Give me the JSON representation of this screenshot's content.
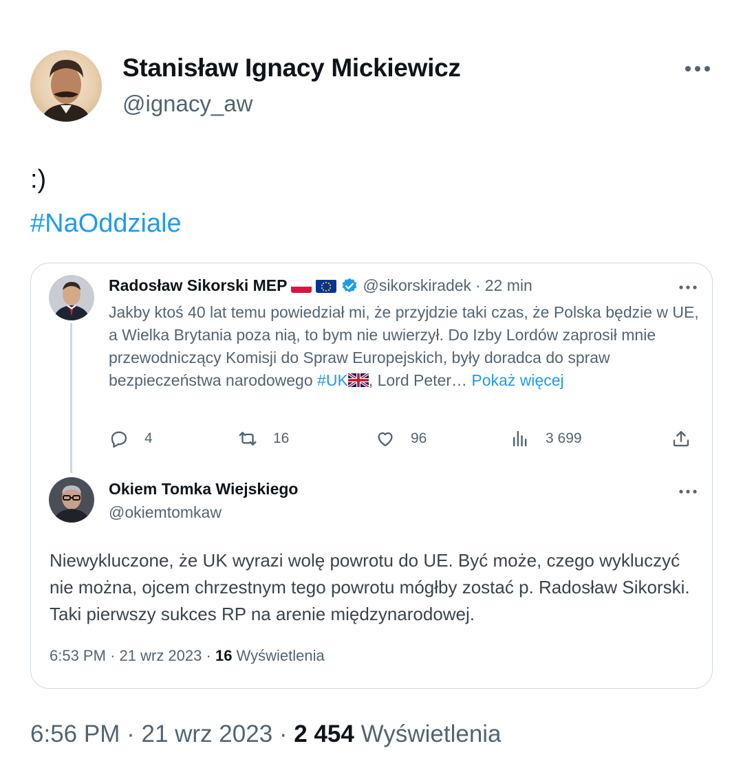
{
  "tweet": {
    "author_name": "Stanisław Ignacy Mickiewicz",
    "author_handle": "@ignacy_aw",
    "text_line1": ":)",
    "hashtag": "#NaOddziale",
    "time": "6:56 PM",
    "sep": "·",
    "date": "21 wrz 2023",
    "views_count": "2 454",
    "views_label": "Wyświetlenia"
  },
  "quote": {
    "first": {
      "author_name": "Radosław Sikorski MEP",
      "author_handle": "@sikorskiradek",
      "sep": "·",
      "time": "22 min",
      "body_text": "Jakby ktoś 40 lat temu powiedział mi, że przyjdzie taki czas, że Polska będzie w UE, a Wielka Brytania poza nią, to bym nie uwierzył. Do Izby Lordów zaprosił mnie przewodniczący Komisji do Spraw Europejskich, były doradca do spraw bezpieczeństwa narodowego ",
      "hashtag": "#UK",
      "body_tail": ", Lord Peter…",
      "show_more": "Pokaż więcej",
      "replies": "4",
      "retweets": "16",
      "likes": "96",
      "views": "3 699"
    },
    "second": {
      "author_name": "Okiem Tomka Wiejskiego",
      "author_handle": "@okiemtomkaw",
      "body_text": "Niewykluczone, że UK wyrazi wolę powrotu do UE. Być może, czego wykluczyć nie można, ojcem chrzestnym tego powrotu mógłby zostać p. Radosław Sikorski. Taki pierwszy sukces RP na arenie międzynarodowej.",
      "time": "6:53 PM",
      "sep": "·",
      "date": "21 wrz 2023",
      "views_count": "16",
      "views_label": "Wyświetlenia"
    }
  },
  "icons": {
    "more": "more-horizontal-icon",
    "reply": "reply-icon",
    "retweet": "retweet-icon",
    "like": "heart-icon",
    "views": "analytics-icon",
    "share": "share-icon",
    "verified": "verified-badge-icon"
  },
  "colors": {
    "accent": "#1d9bf0",
    "text_primary": "#0f1419",
    "text_secondary": "#536471",
    "border": "#cfd9de"
  }
}
